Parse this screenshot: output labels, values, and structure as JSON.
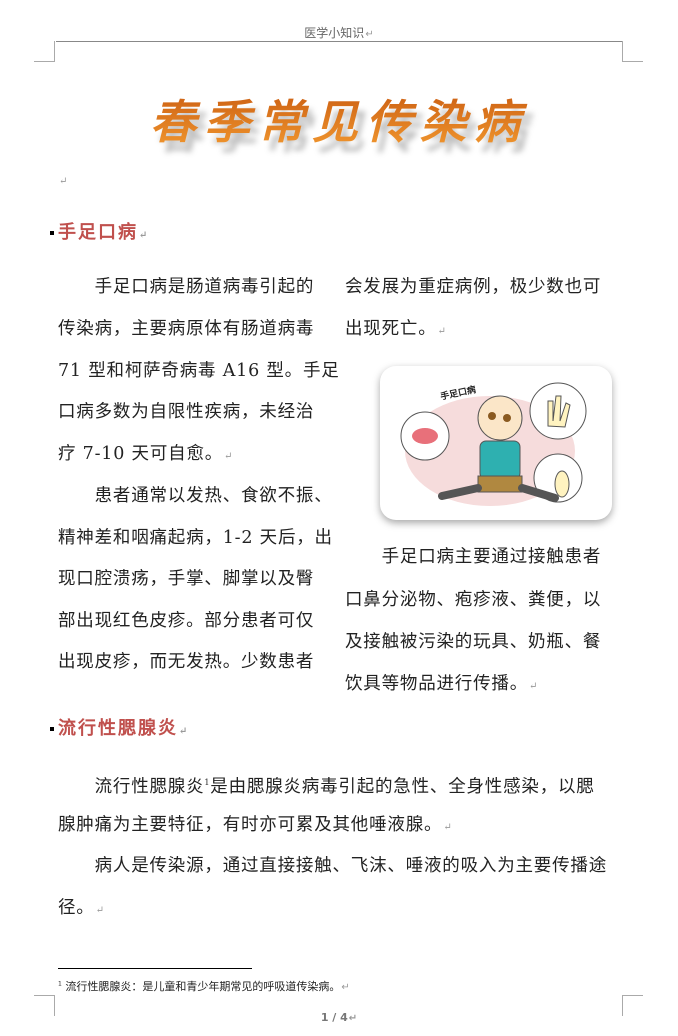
{
  "header": {
    "text": "医学小知识"
  },
  "title": "春季常见传染病",
  "sections": [
    {
      "heading": "手足口病",
      "left_lines": [
        "　　手足口病是肠道病毒引起的",
        "传染病，主要病原体有肠道病毒",
        "71 型和柯萨奇病毒 A16 型。手足",
        "口病多数为自限性疾病，未经治",
        "疗 7-10 天可自愈。",
        "　　患者通常以发热、食欲不振、",
        "精神差和咽痛起病，1-2 天后，出",
        "现口腔溃疡，手掌、脚掌以及臀",
        "部出现红色皮疹。部分患者可仅",
        "出现皮疹，而无发热。少数患者"
      ],
      "right_lines_top": [
        "会发展为重症病例，极少数也可",
        "出现死亡。"
      ],
      "image_label": "手足口病",
      "right_lines_bottom": [
        "　　手足口病主要通过接触患者",
        "口鼻分泌物、疱疹液、粪便，以",
        "及接触被污染的玩具、奶瓶、餐",
        "饮具等物品进行传播。"
      ]
    },
    {
      "heading": "流行性腮腺炎",
      "lines": [
        "　　流行性腮腺炎",
        "是由腮腺炎病毒引起的急性、全身性感染，以腮",
        "腺肿痛为主要特征，有时亦可累及其他唾液腺。",
        "　　病人是传染源，通过直接接触、飞沫、唾液的吸入为主要传播途",
        "径。"
      ],
      "footnote_ref": "1"
    }
  ],
  "footnote": {
    "number": "1",
    "text": "流行性腮腺炎：是儿童和青少年期常见的呼吸道传染病。"
  },
  "page_number": "1 / 4"
}
